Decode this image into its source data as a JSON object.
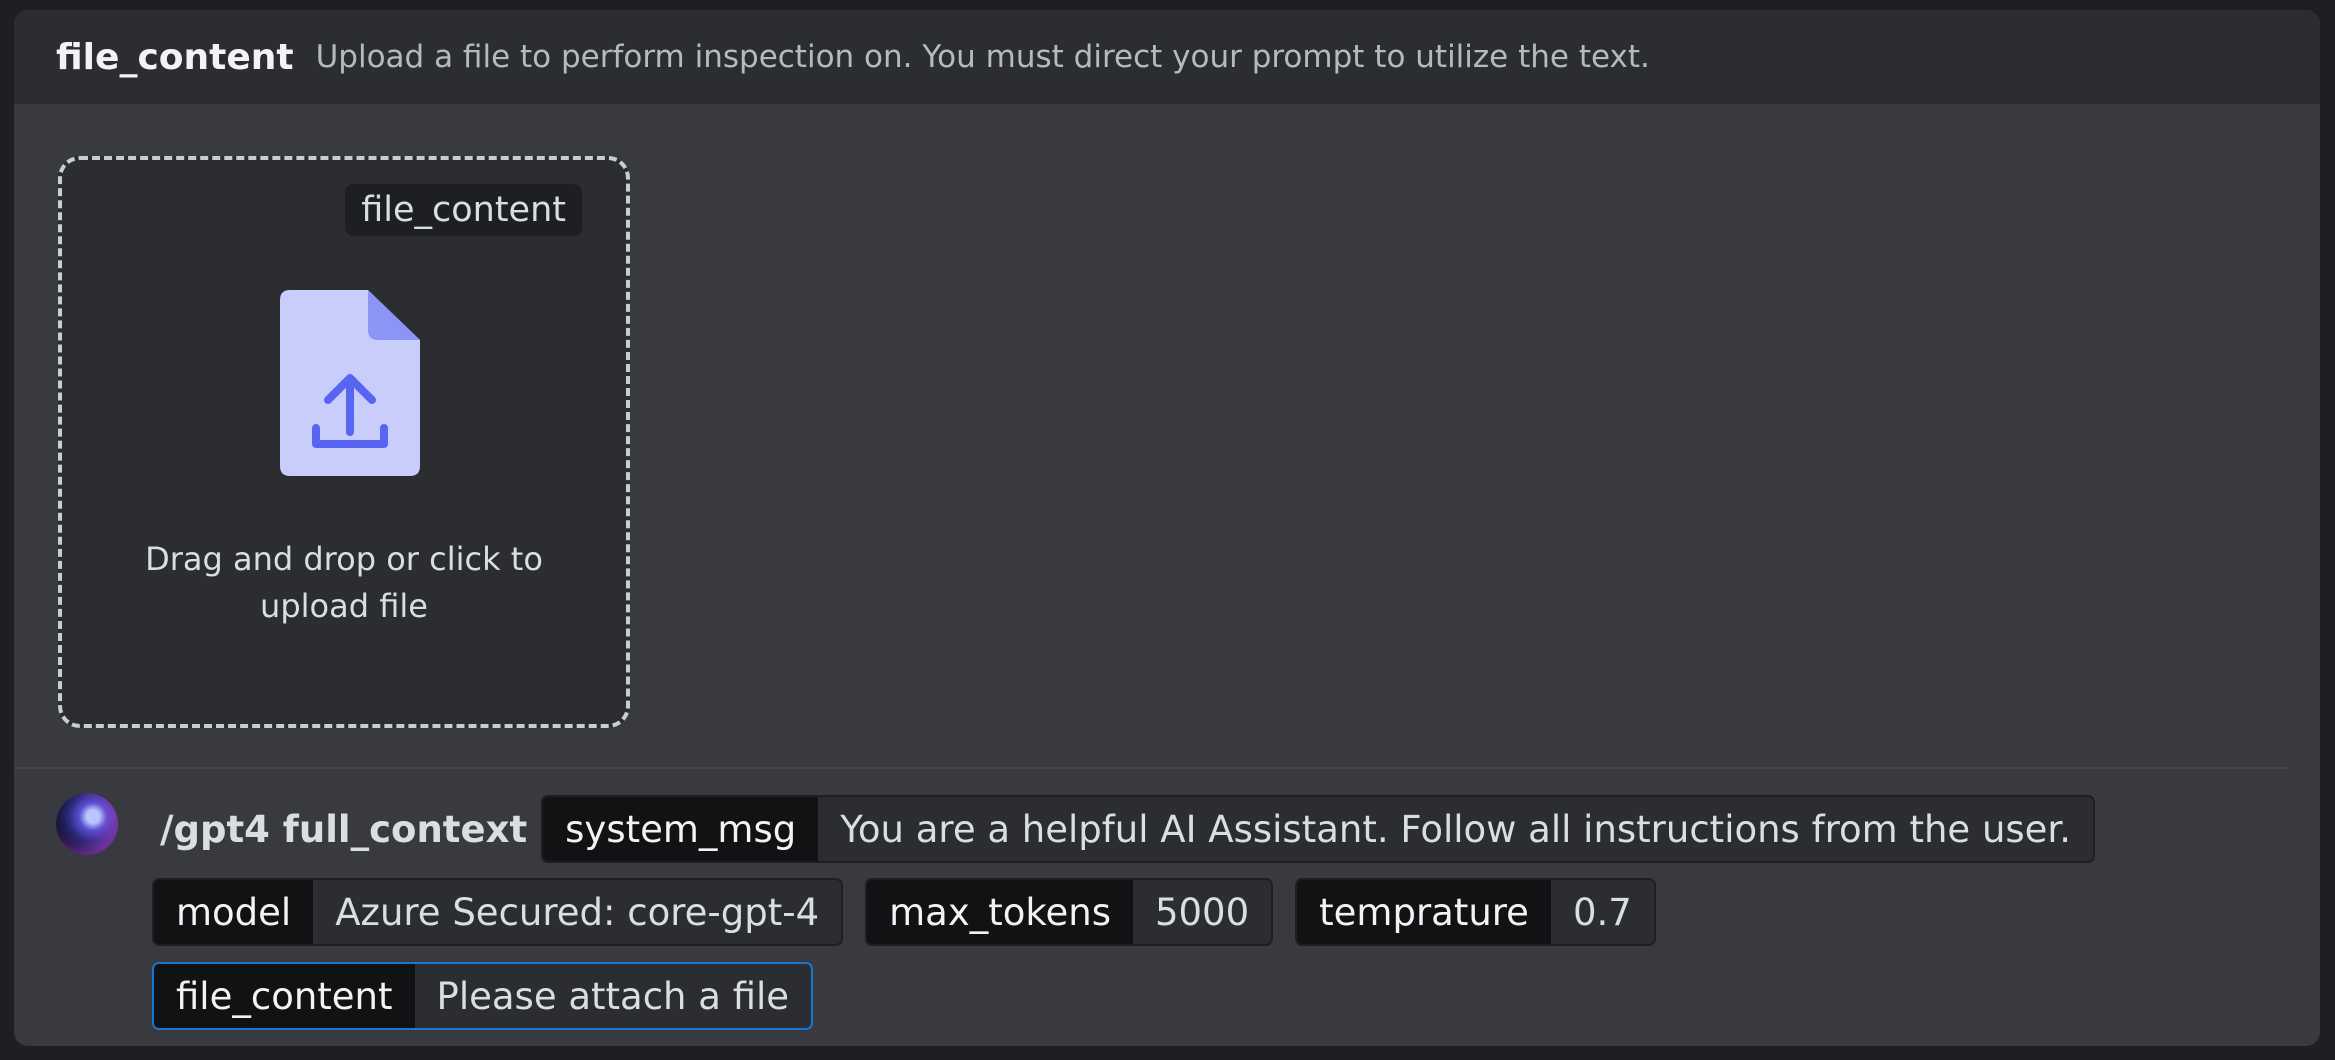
{
  "header": {
    "option_name": "file_content",
    "description": "Upload a file to perform inspection on. You must direct your prompt to utilize the text."
  },
  "dropzone": {
    "tag": "file_content",
    "text_line1": "Drag and drop or click to",
    "text_line2": "upload file",
    "icon": "file-upload-icon"
  },
  "command": {
    "name": "/gpt4 full_context",
    "options": {
      "system_msg": {
        "key": "system_msg",
        "value": "You are a helpful AI Assistant. Follow all instructions from the user."
      },
      "model": {
        "key": "model",
        "value": "Azure Secured: core-gpt-4"
      },
      "max_tokens": {
        "key": "max_tokens",
        "value": "5000"
      },
      "temprature": {
        "key": "temprature",
        "value": "0.7"
      },
      "file_content": {
        "key": "file_content",
        "value": "Please attach a file"
      }
    }
  },
  "colors": {
    "panel_bg": "#383a40",
    "header_bg": "#2b2d31",
    "accent_blue": "#1a74d1",
    "icon_fill": "#c9cdfb",
    "icon_accent": "#5865f2"
  }
}
